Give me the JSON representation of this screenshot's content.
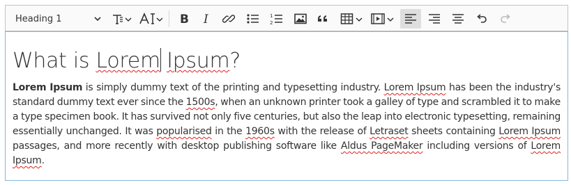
{
  "toolbar": {
    "heading_select": {
      "value": "Heading 1"
    },
    "buttons": [
      {
        "name": "text-style-button",
        "icon": "text-style-icon"
      },
      {
        "name": "font-size-button",
        "icon": "font-size-icon"
      },
      {
        "name": "bold-button",
        "icon": "bold-icon"
      },
      {
        "name": "italic-button",
        "icon": "italic-icon"
      },
      {
        "name": "link-button",
        "icon": "link-icon"
      },
      {
        "name": "bulleted-list-button",
        "icon": "bulleted-list-icon"
      },
      {
        "name": "numbered-list-button",
        "icon": "numbered-list-icon"
      },
      {
        "name": "insert-image-button",
        "icon": "image-icon"
      },
      {
        "name": "block-quote-button",
        "icon": "quote-icon"
      },
      {
        "name": "insert-table-button",
        "icon": "table-icon"
      },
      {
        "name": "insert-media-button",
        "icon": "media-icon"
      },
      {
        "name": "align-left-button",
        "icon": "align-left-icon",
        "active": true
      },
      {
        "name": "align-right-button",
        "icon": "align-right-icon"
      },
      {
        "name": "align-center-button",
        "icon": "align-center-icon"
      },
      {
        "name": "undo-button",
        "icon": "undo-icon"
      },
      {
        "name": "redo-button",
        "icon": "redo-icon",
        "disabled": true
      }
    ]
  },
  "content": {
    "heading": {
      "before_caret": "What is Lorem",
      "after_caret": " Ipsum?"
    },
    "paragraph": {
      "s1": "Lorem Ipsum",
      "s2": " is simply dummy text of the printing and typesetting industry. ",
      "s3": "Lorem Ipsum",
      "s4": " has been the industry's standard dummy text ever since the ",
      "s5": "1500s",
      "s6": ", when an unknown printer took a galley of type and scrambled it to make a type specimen book. It has survived not only five centuries, but also the leap into electronic typesetting, remaining essentially unchanged. It was ",
      "s7": "popularised",
      "s8": " in the ",
      "s9": "1960s",
      "s10": " with the release of ",
      "s11": "Letraset",
      "s12": " sheets containing ",
      "s13": "Lorem Ipsum",
      "s14": " passages, and more recently with desktop publishing software like ",
      "s15": "Aldus PageMaker",
      "s16": " including versions of ",
      "s17": "Lorem Ipsum",
      "s18": "."
    }
  },
  "colors": {
    "accent_border": "#87b6dc",
    "spell_error": "#e02020",
    "active_button": "#dedede"
  }
}
